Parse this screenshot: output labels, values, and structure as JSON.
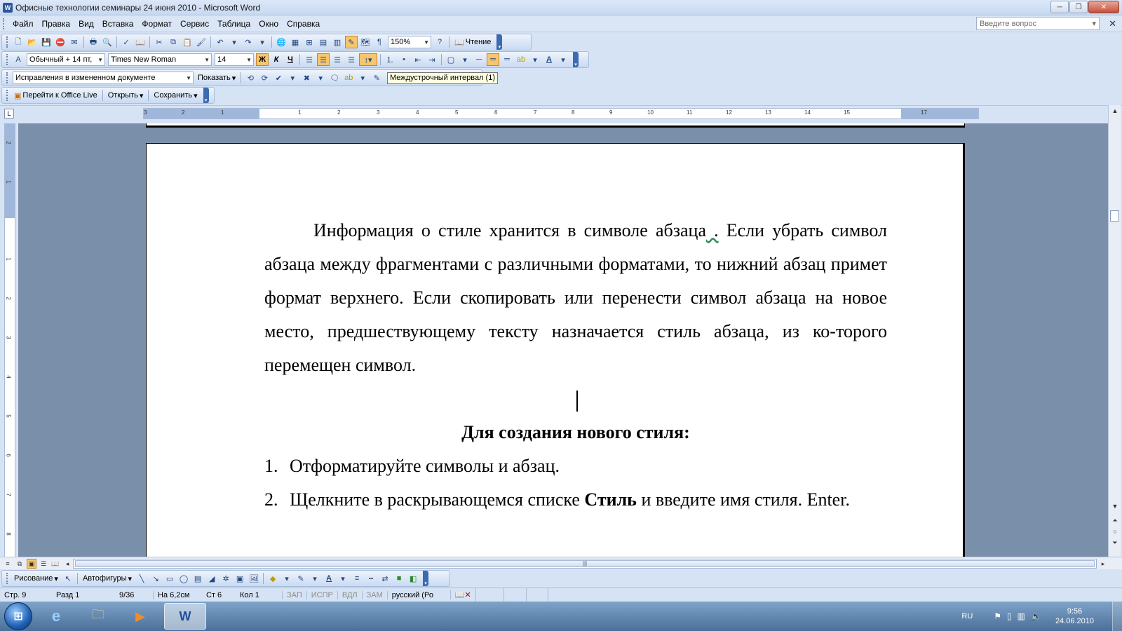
{
  "window": {
    "title": "Офисные технологии семинары 24 июня 2010 - Microsoft Word",
    "app_icon": "word-icon",
    "buttons": [
      "minimize",
      "maximize",
      "close"
    ]
  },
  "menu": {
    "items": [
      "Файл",
      "Правка",
      "Вид",
      "Вставка",
      "Формат",
      "Сервис",
      "Таблица",
      "Окно",
      "Справка"
    ],
    "help_placeholder": "Введите вопрос"
  },
  "standard_toolbar": {
    "zoom": "150%",
    "reading_label": "Чтение"
  },
  "formatting_toolbar": {
    "style": "Обычный + 14 пт,",
    "font": "Times New Roman",
    "size": "14",
    "bold": "Ж",
    "italic": "К",
    "underline": "Ч"
  },
  "reviewing_toolbar": {
    "mode": "Исправления в измененном документе",
    "show_label": "Показать"
  },
  "office_live_toolbar": {
    "goto": "Перейти к Office Live",
    "open": "Открыть",
    "save": "Сохранить"
  },
  "tooltip": "Междустрочный интервал (1)",
  "ruler": {
    "h_numbers": [
      "3",
      "2",
      "1",
      "1",
      "2",
      "3",
      "4",
      "5",
      "6",
      "7",
      "8",
      "9",
      "10",
      "11",
      "12",
      "13",
      "14",
      "15",
      "17"
    ],
    "v_numbers": [
      "2",
      "1",
      "1",
      "2",
      "3",
      "4",
      "5",
      "6",
      "7",
      "8"
    ]
  },
  "document": {
    "para_before": "Информация о стиле хранится в символе абзаца",
    "para_mark": " .",
    "para_after": " Если убрать символ абзаца между фрагментами с различными форматами, то нижний абзац примет формат верхнего. Если скопировать или перенести символ абзаца на новое место, предшествующему тексту назначается стиль абзаца, из ко-торого перемещен символ.",
    "heading": "Для создания нового стиля:",
    "list": [
      {
        "num": "1.",
        "text_before": "Отформатируйте символы и абзац.",
        "bold": "",
        "text_after": ""
      },
      {
        "num": "2.",
        "text_before": "Щелкните в раскрывающемся списке ",
        "bold": "Стиль",
        "text_after": " и введите имя стиля. Enter."
      }
    ]
  },
  "drawing_toolbar": {
    "drawing": "Рисование",
    "autoshapes": "Автофигуры"
  },
  "statusbar": {
    "page": "Стр. 9",
    "section": "Разд 1",
    "pages": "9/36",
    "at": "На 6,2см",
    "line": "Ст 6",
    "col": "Кол 1",
    "rec": "ЗАП",
    "trk": "ИСПР",
    "ext": "ВДЛ",
    "ovr": "ЗАМ",
    "lang": "русский (Ро"
  },
  "taskbar": {
    "lang": "RU",
    "time": "9:56",
    "date": "24.06.2010"
  }
}
